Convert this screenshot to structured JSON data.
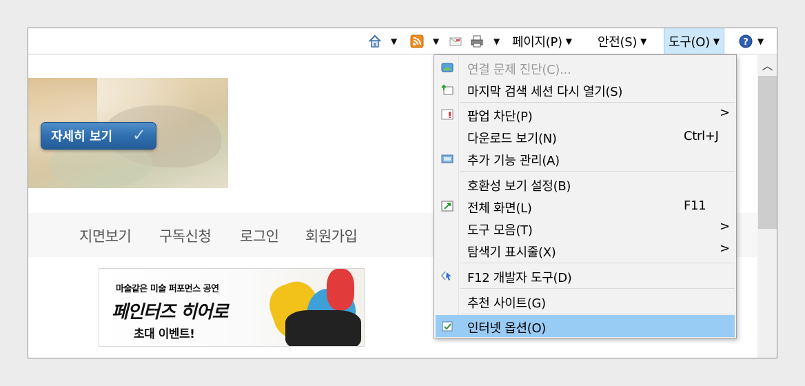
{
  "toolbar": {
    "page": "페이지(P)",
    "safety": "안전(S)",
    "tools": "도구(O)"
  },
  "hero": {
    "button_label": "자세히 보기"
  },
  "nav": {
    "links": [
      "지면보기",
      "구독신청",
      "로그인",
      "회원가입"
    ]
  },
  "banner": {
    "line1": "마술같은 미술 퍼포먼스 공연",
    "line2": "페인터즈 히어로",
    "line3": "초대 이벤트!"
  },
  "menu": {
    "items": [
      {
        "label": "연결 문제 진단(C)...",
        "icon": "network-diagnose-icon",
        "disabled": true
      },
      {
        "label": "마지막 검색 세션 다시 열기(S)",
        "icon": "reopen-session-icon"
      },
      {
        "label": "팝업 차단(P)",
        "icon": "popup-blocker-icon",
        "submenu": true
      },
      {
        "label": "다운로드 보기(N)",
        "shortcut": "Ctrl+J"
      },
      {
        "label": "추가 기능 관리(A)",
        "icon": "addons-icon"
      },
      {
        "label": "호환성 보기 설정(B)"
      },
      {
        "label": "전체 화면(L)",
        "icon": "fullscreen-icon",
        "shortcut": "F11"
      },
      {
        "label": "도구 모음(T)",
        "submenu": true
      },
      {
        "label": "탐색기 표시줄(X)",
        "submenu": true
      },
      {
        "label": "F12 개발자 도구(D)",
        "icon": "dev-tools-icon"
      },
      {
        "label": "추천 사이트(G)"
      },
      {
        "label": "인터넷 옵션(O)",
        "icon": "internet-options-icon",
        "selected": true
      }
    ],
    "submenu_glyph": ">"
  },
  "colors": {
    "selected_bg": "#99ccf5",
    "tools_highlight": "#cde8fb"
  }
}
